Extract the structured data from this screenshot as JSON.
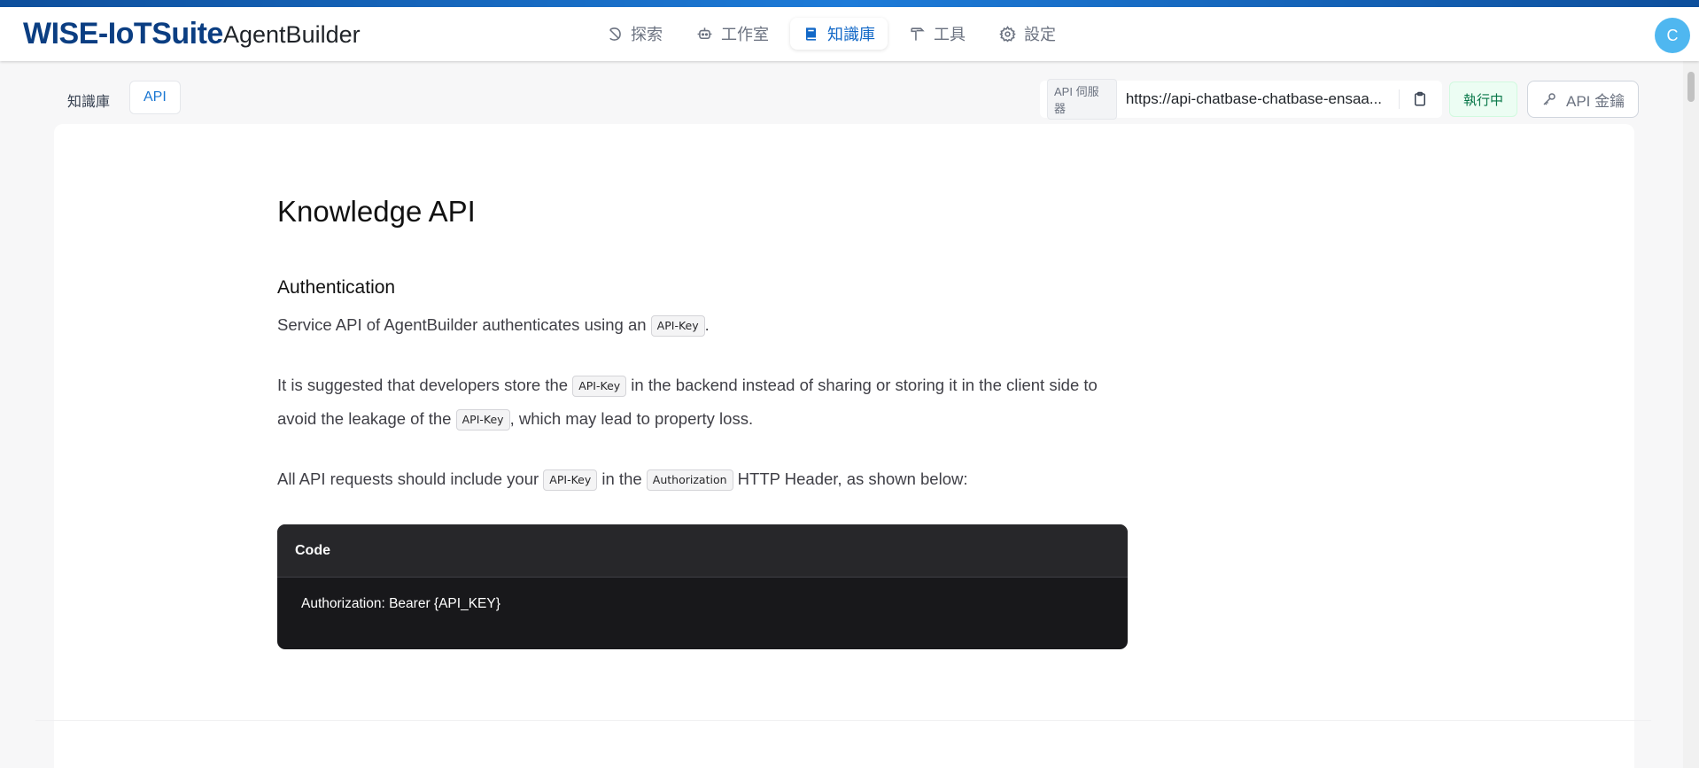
{
  "header": {
    "logo": "WISE-IoTSuite",
    "app_name": "AgentBuilder",
    "nav": [
      {
        "label": "探索",
        "icon": "compass-icon"
      },
      {
        "label": "工作室",
        "icon": "robot-icon"
      },
      {
        "label": "知識庫",
        "icon": "book-icon",
        "active": true
      },
      {
        "label": "工具",
        "icon": "hammer-icon"
      },
      {
        "label": "設定",
        "icon": "gear-icon"
      }
    ],
    "avatar_initial": "C"
  },
  "subbar": {
    "breadcrumb": "知識庫",
    "active_tab": "API",
    "server_tag": "API 伺服器",
    "server_url": "https://api-chatbase-chatbase-ensaa...",
    "status": "執行中",
    "api_key_button": "API 金鑰"
  },
  "doc": {
    "title": "Knowledge API",
    "section": "Authentication",
    "p1": {
      "before": "Service API of AgentBuilder authenticates using an ",
      "chip": "API-Key",
      "after": "."
    },
    "p2": {
      "a": "It is suggested that developers store the ",
      "chip1": "API-Key",
      "b": " in the backend instead of sharing or storing it in the client side to avoid the leakage of the ",
      "chip2": "API-Key",
      "c": ", which may lead to property loss."
    },
    "p3": {
      "a": "All API requests should include your ",
      "chip1": "API-Key",
      "b": " in the ",
      "chip2": "Authorization",
      "c": " HTTP Header, as shown below:"
    },
    "code": {
      "header": "Code",
      "content": "Authorization: Bearer {API_KEY}"
    }
  },
  "colors": {
    "brand": "#0b3e82",
    "accent": "#1268c7",
    "status_green": "#067647",
    "code_bg": "#18181b"
  }
}
